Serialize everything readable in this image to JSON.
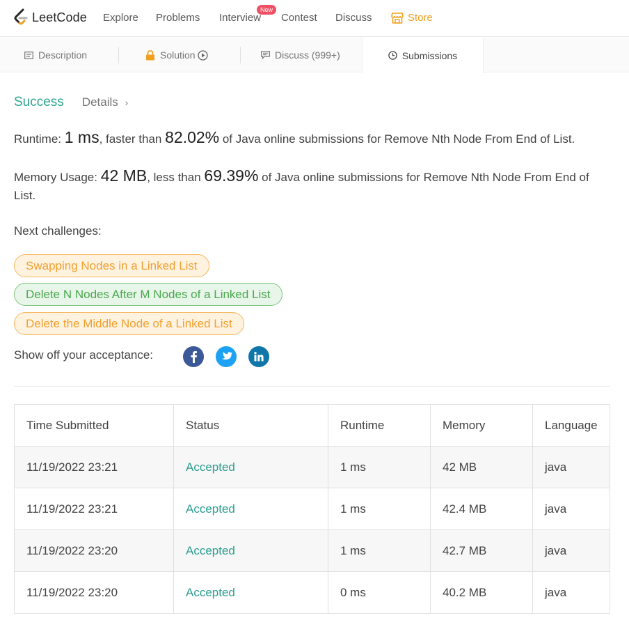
{
  "nav": {
    "logo_text": "LeetCode",
    "items": [
      "Explore",
      "Problems",
      "Interview",
      "Contest",
      "Discuss"
    ],
    "new_badge": "New",
    "store": "Store"
  },
  "tabs": {
    "description": "Description",
    "solution": "Solution",
    "discuss": "Discuss (999+)",
    "submissions": "Submissions"
  },
  "result": {
    "status": "Success",
    "details": "Details",
    "runtime_label": "Runtime: ",
    "runtime_value": "1 ms",
    "runtime_mid": ", faster than ",
    "runtime_pct": "82.02%",
    "runtime_tail": " of Java online submissions for Remove Nth Node From End of List.",
    "memory_label": "Memory Usage: ",
    "memory_value": "42 MB",
    "memory_mid": ", less than ",
    "memory_pct": "69.39%",
    "memory_tail": " of Java online submissions for Remove Nth Node From End of List."
  },
  "next": {
    "label": "Next challenges:",
    "challenges": [
      "Swapping Nodes in a Linked List",
      "Delete N Nodes After M Nodes of a Linked List",
      "Delete the Middle Node of a Linked List"
    ]
  },
  "share": {
    "label": "Show off your acceptance:"
  },
  "colors": {
    "accent_green": "#2ca58d",
    "orange": "#f0a030",
    "facebook": "#3b5998",
    "twitter": "#1da1f2",
    "linkedin": "#0e76a8"
  },
  "table": {
    "headers": [
      "Time Submitted",
      "Status",
      "Runtime",
      "Memory",
      "Language"
    ],
    "rows": [
      [
        "11/19/2022 23:21",
        "Accepted",
        "1 ms",
        "42 MB",
        "java"
      ],
      [
        "11/19/2022 23:21",
        "Accepted",
        "1 ms",
        "42.4 MB",
        "java"
      ],
      [
        "11/19/2022 23:20",
        "Accepted",
        "1 ms",
        "42.7 MB",
        "java"
      ],
      [
        "11/19/2022 23:20",
        "Accepted",
        "0 ms",
        "40.2 MB",
        "java"
      ]
    ]
  }
}
